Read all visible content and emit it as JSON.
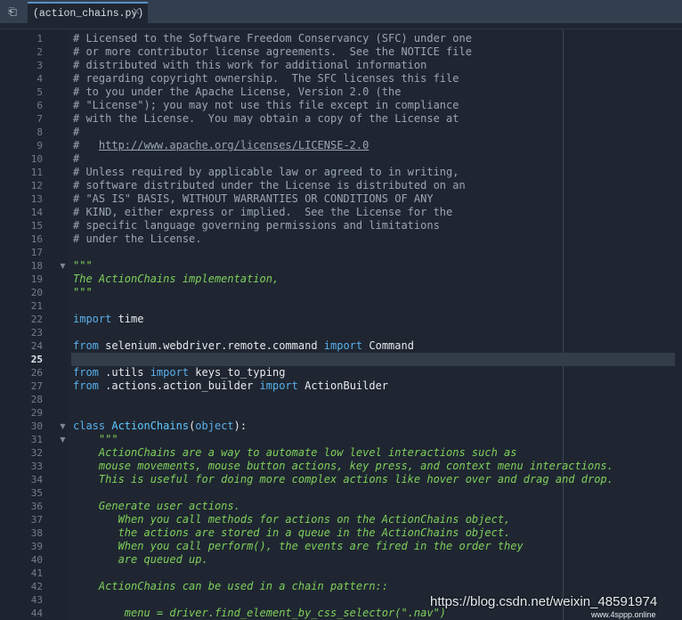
{
  "tabbar": {
    "toggle_icon": "panel-toggle-icon",
    "tab_title": "(action_chains.py)",
    "close_label": "✕"
  },
  "editor": {
    "active_line": 25,
    "lines": [
      {
        "n": "1",
        "tokens": [
          {
            "t": "# Licensed to the Software Freedom Conservancy (SFC) under one",
            "c": "comment"
          }
        ]
      },
      {
        "n": "2",
        "tokens": [
          {
            "t": "# or more contributor license agreements.  See the NOTICE file",
            "c": "comment"
          }
        ]
      },
      {
        "n": "3",
        "tokens": [
          {
            "t": "# distributed with this work for additional information",
            "c": "comment"
          }
        ]
      },
      {
        "n": "4",
        "tokens": [
          {
            "t": "# regarding copyright ownership.  The SFC licenses this file",
            "c": "comment"
          }
        ]
      },
      {
        "n": "5",
        "tokens": [
          {
            "t": "# to you under the Apache License, Version 2.0 (the",
            "c": "comment"
          }
        ]
      },
      {
        "n": "6",
        "tokens": [
          {
            "t": "# \"License\"); you may not use this file except in compliance",
            "c": "comment"
          }
        ]
      },
      {
        "n": "7",
        "tokens": [
          {
            "t": "# with the License.  You may obtain a copy of the License at",
            "c": "comment"
          }
        ]
      },
      {
        "n": "8",
        "tokens": [
          {
            "t": "#",
            "c": "comment"
          }
        ]
      },
      {
        "n": "9",
        "tokens": [
          {
            "t": "#   ",
            "c": "comment"
          },
          {
            "t": "http://www.apache.org/licenses/LICENSE-2.0",
            "c": "url"
          }
        ]
      },
      {
        "n": "10",
        "tokens": [
          {
            "t": "#",
            "c": "comment"
          }
        ]
      },
      {
        "n": "11",
        "tokens": [
          {
            "t": "# Unless required by applicable law or agreed to in writing,",
            "c": "comment"
          }
        ]
      },
      {
        "n": "12",
        "tokens": [
          {
            "t": "# software distributed under the License is distributed on an",
            "c": "comment"
          }
        ]
      },
      {
        "n": "13",
        "tokens": [
          {
            "t": "# \"AS IS\" BASIS, WITHOUT WARRANTIES OR CONDITIONS OF ANY",
            "c": "comment"
          }
        ]
      },
      {
        "n": "14",
        "tokens": [
          {
            "t": "# KIND, either express or implied.  See the License for the",
            "c": "comment"
          }
        ]
      },
      {
        "n": "15",
        "tokens": [
          {
            "t": "# specific language governing permissions and limitations",
            "c": "comment"
          }
        ]
      },
      {
        "n": "16",
        "tokens": [
          {
            "t": "# under the License.",
            "c": "comment"
          }
        ]
      },
      {
        "n": "17",
        "tokens": []
      },
      {
        "n": "18",
        "fold": true,
        "tokens": [
          {
            "t": "\"\"\"",
            "c": "doc"
          }
        ]
      },
      {
        "n": "19",
        "tokens": [
          {
            "t": "The ActionChains implementation,",
            "c": "doc"
          }
        ]
      },
      {
        "n": "20",
        "tokens": [
          {
            "t": "\"\"\"",
            "c": "doc"
          }
        ]
      },
      {
        "n": "21",
        "tokens": []
      },
      {
        "n": "22",
        "tokens": [
          {
            "t": "import",
            "c": "kw"
          },
          {
            "t": " time",
            "c": "plain"
          }
        ]
      },
      {
        "n": "23",
        "tokens": []
      },
      {
        "n": "24",
        "tokens": [
          {
            "t": "from",
            "c": "kw"
          },
          {
            "t": " selenium.webdriver.remote.command ",
            "c": "plain"
          },
          {
            "t": "import",
            "c": "kw"
          },
          {
            "t": " Command",
            "c": "plain"
          }
        ]
      },
      {
        "n": "25",
        "tokens": []
      },
      {
        "n": "26",
        "tokens": [
          {
            "t": "from",
            "c": "kw"
          },
          {
            "t": " .utils ",
            "c": "plain"
          },
          {
            "t": "import",
            "c": "kw"
          },
          {
            "t": " keys_to_typing",
            "c": "plain"
          }
        ]
      },
      {
        "n": "27",
        "tokens": [
          {
            "t": "from",
            "c": "kw"
          },
          {
            "t": " .actions.action_builder ",
            "c": "plain"
          },
          {
            "t": "import",
            "c": "kw"
          },
          {
            "t": " ActionBuilder",
            "c": "plain"
          }
        ]
      },
      {
        "n": "28",
        "tokens": []
      },
      {
        "n": "29",
        "tokens": []
      },
      {
        "n": "30",
        "fold": true,
        "tokens": [
          {
            "t": "class",
            "c": "kw"
          },
          {
            "t": " ",
            "c": "plain"
          },
          {
            "t": "ActionChains",
            "c": "cls"
          },
          {
            "t": "(",
            "c": "punct"
          },
          {
            "t": "object",
            "c": "kw"
          },
          {
            "t": "):",
            "c": "punct"
          }
        ]
      },
      {
        "n": "31",
        "fold": true,
        "tokens": [
          {
            "t": "    \"\"\"",
            "c": "doc"
          }
        ]
      },
      {
        "n": "32",
        "tokens": [
          {
            "t": "    ActionChains are a way to automate low level interactions such as",
            "c": "doc"
          }
        ]
      },
      {
        "n": "33",
        "tokens": [
          {
            "t": "    mouse movements, mouse button actions, key press, and context menu interactions.",
            "c": "doc"
          }
        ]
      },
      {
        "n": "34",
        "tokens": [
          {
            "t": "    This is useful for doing more complex actions like hover over and drag and drop.",
            "c": "doc"
          }
        ]
      },
      {
        "n": "35",
        "tokens": []
      },
      {
        "n": "36",
        "tokens": [
          {
            "t": "    Generate user actions.",
            "c": "doc"
          }
        ]
      },
      {
        "n": "37",
        "tokens": [
          {
            "t": "       When you call methods for actions on the ActionChains object,",
            "c": "doc"
          }
        ]
      },
      {
        "n": "38",
        "tokens": [
          {
            "t": "       the actions are stored in a queue in the ActionChains object.",
            "c": "doc"
          }
        ]
      },
      {
        "n": "39",
        "tokens": [
          {
            "t": "       When you call perform(), the events are fired in the order they",
            "c": "doc"
          }
        ]
      },
      {
        "n": "40",
        "tokens": [
          {
            "t": "       are queued up.",
            "c": "doc"
          }
        ]
      },
      {
        "n": "41",
        "tokens": []
      },
      {
        "n": "42",
        "tokens": [
          {
            "t": "    ActionChains can be used in a chain pattern::",
            "c": "doc"
          }
        ]
      },
      {
        "n": "43",
        "tokens": []
      },
      {
        "n": "44",
        "tokens": [
          {
            "t": "        menu = driver.find_element_by_css_selector(\".nav\")",
            "c": "doc"
          }
        ]
      }
    ]
  },
  "watermark": {
    "text": "https://blog.csdn.net/weixin_48591974",
    "subtext": "www.4sppp.online"
  }
}
